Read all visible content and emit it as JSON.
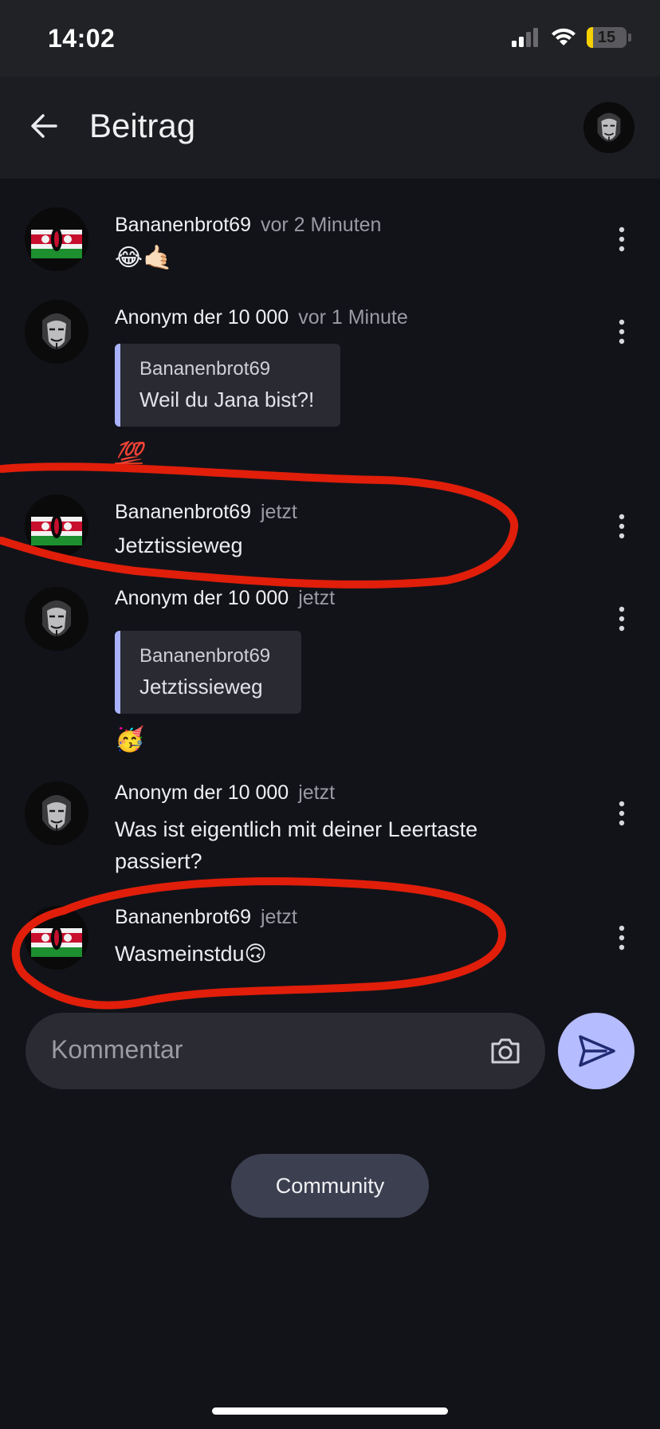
{
  "status_bar": {
    "time": "14:02",
    "battery_level": "15",
    "battery_fraction": 0.15
  },
  "header": {
    "title": "Beitrag",
    "back_icon": "arrow-left-icon",
    "avatar_icon": "anonymous-mask-avatar"
  },
  "comments": [
    {
      "author": "Bananenbrot69",
      "time": "vor 2 Minuten",
      "avatar": "kenya-flag-avatar",
      "text": "😂🤙🏻"
    },
    {
      "author": "Anonym der 10 000",
      "time": "vor 1 Minute",
      "avatar": "anonymous-mask-avatar",
      "quote": {
        "author": "Bananenbrot69",
        "text": "Weil du Jana bist?!"
      },
      "text": "💯"
    },
    {
      "author": "Bananenbrot69",
      "time": "jetzt",
      "avatar": "kenya-flag-avatar",
      "text": "Jetztissieweg"
    },
    {
      "author": "Anonym der 10 000",
      "time": "jetzt",
      "avatar": "anonymous-mask-avatar",
      "quote": {
        "author": "Bananenbrot69",
        "text": "Jetztissieweg"
      },
      "text": "🥳"
    },
    {
      "author": "Anonym der 10 000",
      "time": "jetzt",
      "avatar": "anonymous-mask-avatar",
      "text": "Was ist eigentlich mit deiner Leertaste passiert?"
    },
    {
      "author": "Bananenbrot69",
      "time": "jetzt",
      "avatar": "kenya-flag-avatar",
      "text": "Wasmeinstdu🙃"
    }
  ],
  "composer": {
    "placeholder": "Kommentar",
    "camera_icon": "camera-icon",
    "send_icon": "send-icon"
  },
  "footer": {
    "community_label": "Community"
  },
  "colors": {
    "background": "#121319",
    "accent": "#b5bcff",
    "annotation": "#e01e0a"
  }
}
